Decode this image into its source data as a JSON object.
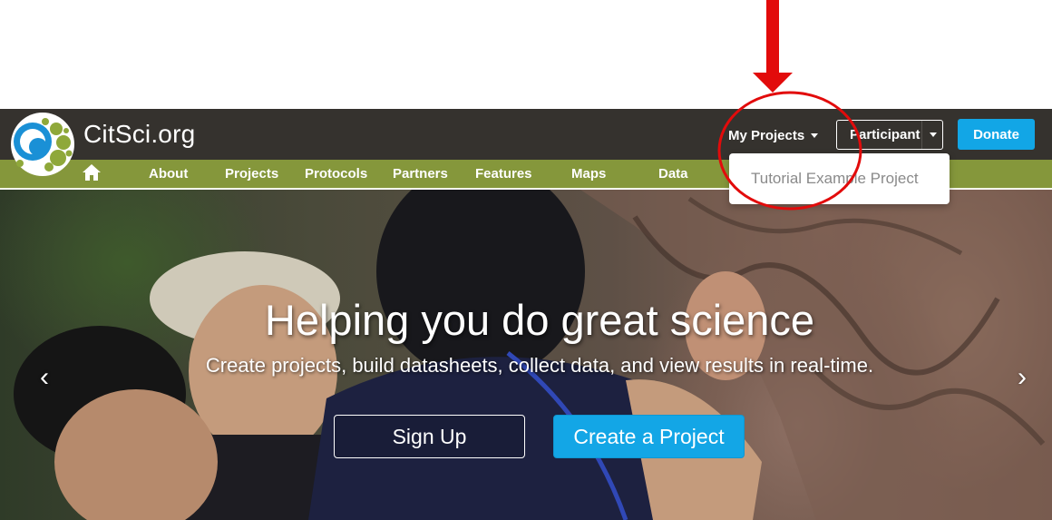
{
  "brand": {
    "name": "CitSci.org"
  },
  "header": {
    "my_projects": "My Projects",
    "participant": "Participant",
    "donate": "Donate"
  },
  "dropdown": {
    "items": [
      "Tutorial Example Project"
    ]
  },
  "subnav": {
    "items": [
      "About",
      "Projects",
      "Protocols",
      "Partners",
      "Features",
      "Maps",
      "Data"
    ]
  },
  "hero": {
    "title": "Helping you do great science",
    "subtitle": "Create projects, build datasheets, collect data, and view results in real-time.",
    "signup": "Sign Up",
    "create": "Create a Project",
    "prev": "‹",
    "next": "›"
  },
  "colors": {
    "nav_dark": "#35322e",
    "nav_green": "#85973b",
    "accent_blue": "#12a6e6",
    "annotation_red": "#e20b0b"
  },
  "icons": {
    "home": "home-icon",
    "logo": "citsci-logo",
    "arrow": "red-down-arrow-annotation",
    "circle": "red-circle-annotation"
  }
}
